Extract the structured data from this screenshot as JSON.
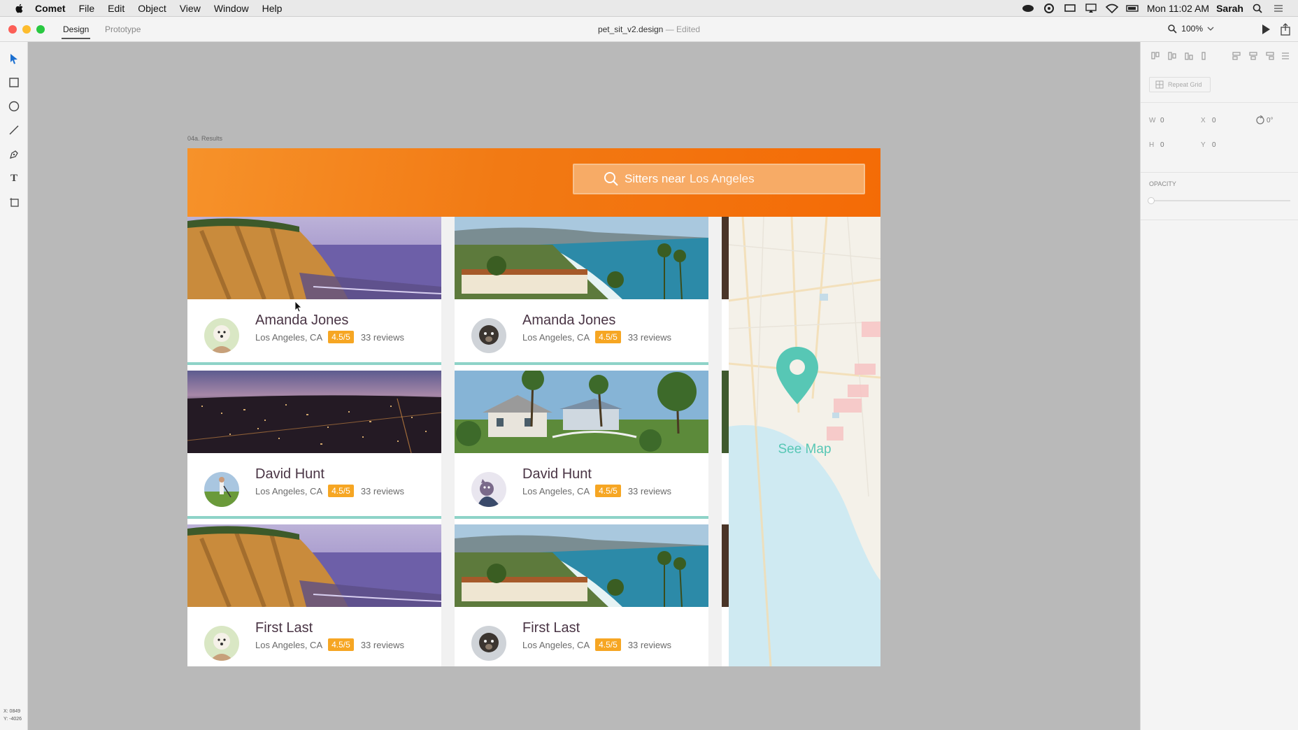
{
  "menubar": {
    "app": "Comet",
    "items": [
      "File",
      "Edit",
      "Object",
      "View",
      "Window",
      "Help"
    ],
    "clock": "Mon 11:02 AM",
    "user": "Sarah"
  },
  "titlebar": {
    "tabs": [
      "Design",
      "Prototype"
    ],
    "active_tab": "Design",
    "document": "pet_sit_v2.design",
    "status": "— Edited",
    "zoom": "100%"
  },
  "panel": {
    "repeat_grid": "Repeat Grid",
    "w_label": "W",
    "w_value": "0",
    "x_label": "X",
    "x_value": "0",
    "h_label": "H",
    "h_value": "0",
    "y_label": "Y",
    "y_value": "0",
    "rotation": "0°",
    "opacity_label": "OPACITY"
  },
  "coords": {
    "x": "X: 0849",
    "y": "Y: -4026"
  },
  "artboard": {
    "label": "04a. Results",
    "search": {
      "prefix": "Sitters near",
      "location": "Los Angeles"
    },
    "see_map": "See Map",
    "cards": [
      {
        "name": "Amanda Jones",
        "location": "Los Angeles, CA",
        "rating": "4.5/5",
        "reviews": "33 reviews",
        "photo": "cliff",
        "avatar": "dog-white"
      },
      {
        "name": "Amanda Jones",
        "location": "Los Angeles, CA",
        "rating": "4.5/5",
        "reviews": "33 reviews",
        "photo": "coast",
        "avatar": "dog-dark"
      },
      {
        "name": "David Hunt",
        "location": "Los Angeles, CA",
        "rating": "4.5/5",
        "reviews": "33 reviews",
        "photo": "city-night",
        "avatar": "golf"
      },
      {
        "name": "David Hunt",
        "location": "Los Angeles, CA",
        "rating": "4.5/5",
        "reviews": "33 reviews",
        "photo": "house",
        "avatar": "cat"
      },
      {
        "name": "First Last",
        "location": "Los Angeles, CA",
        "rating": "4.5/5",
        "reviews": "33 reviews",
        "photo": "cliff",
        "avatar": "dog-white"
      },
      {
        "name": "First Last",
        "location": "Los Angeles, CA",
        "rating": "4.5/5",
        "reviews": "33 reviews",
        "photo": "coast",
        "avatar": "dog-dark"
      }
    ]
  },
  "colors": {
    "hero": "#f27a14",
    "badge": "#f6a623",
    "accent": "#8ed3c8",
    "pin": "#57c7b5"
  }
}
